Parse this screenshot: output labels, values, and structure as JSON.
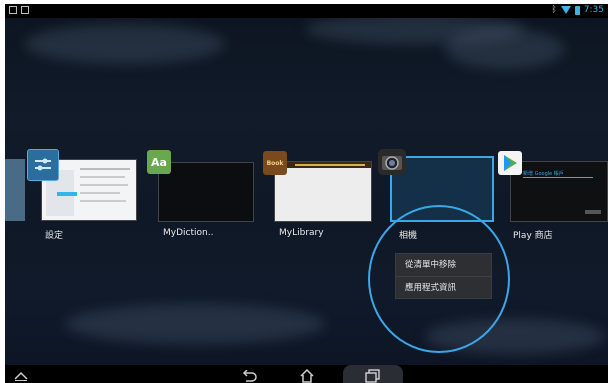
{
  "status_bar": {
    "time": "7:35"
  },
  "recent_apps": [
    {
      "label": "設定",
      "icon": "settings-icon"
    },
    {
      "label": "MyDiction..",
      "icon": "dictionary-icon",
      "icon_text": "Aa"
    },
    {
      "label": "MyLibrary",
      "icon": "library-icon",
      "icon_text": "Book"
    },
    {
      "label": "相機",
      "icon": "camera-icon"
    },
    {
      "label": "Play 商店",
      "icon": "play-store-icon",
      "thumb_text": "新增 Google 帳戶"
    }
  ],
  "context_menu": {
    "items": [
      "從清單中移除",
      "應用程式資訊"
    ]
  },
  "nav_bar": {
    "back_icon": "back-icon",
    "home_icon": "home-icon",
    "recents_icon": "recents-icon",
    "menu_icon": "chevron-up-icon"
  },
  "colors": {
    "accent": "#3ba6e8"
  }
}
